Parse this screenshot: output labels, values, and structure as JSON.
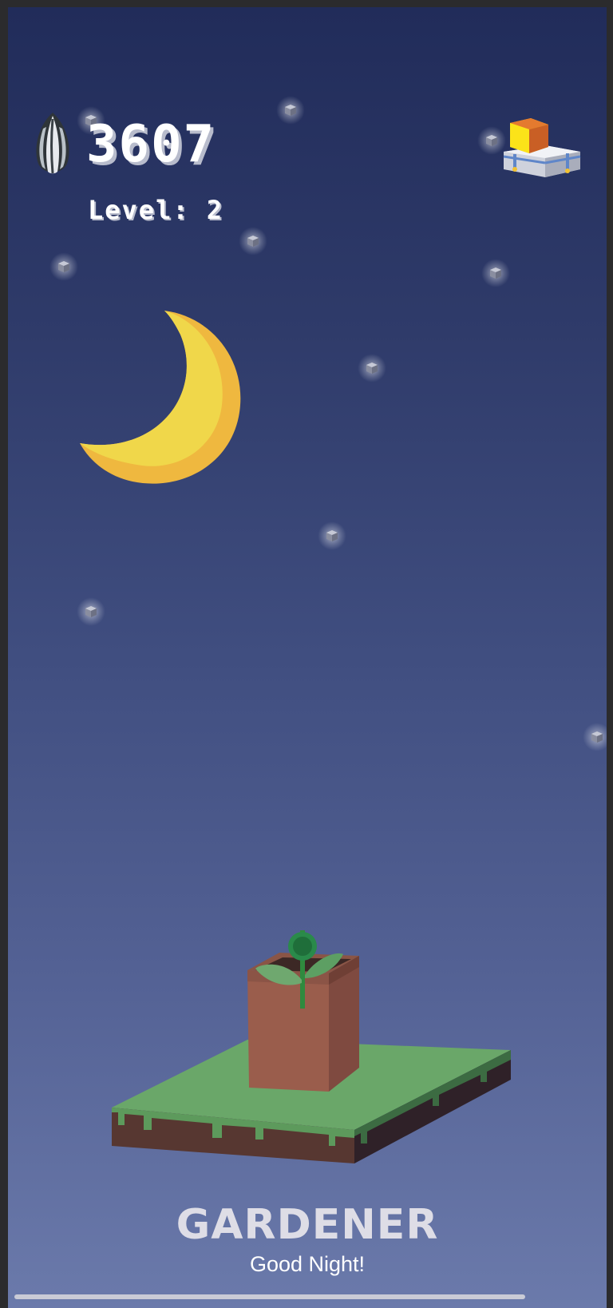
{
  "hud": {
    "seed_icon": "sunflower-seed-icon",
    "seeds": "3607",
    "level": "Level: 2",
    "shop_icon": "treasure-chest-icon"
  },
  "game": {
    "title": "GARDENER",
    "subtitle": "Good Night!"
  },
  "scene": {
    "time_of_day": "night",
    "sky_colors": [
      "#212c5a",
      "#6b7aab"
    ],
    "moon_color": "#f1d849"
  }
}
